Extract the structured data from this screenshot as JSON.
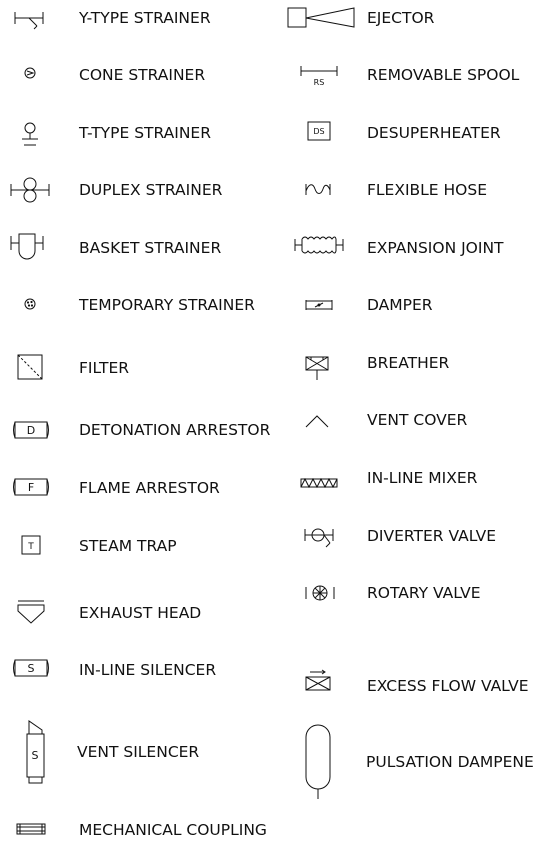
{
  "left_items": [
    {
      "label": "Y-TYPE STRAINER",
      "icon": "y-type-strainer"
    },
    {
      "label": "CONE STRAINER",
      "icon": "cone-strainer"
    },
    {
      "label": "T-TYPE STRAINER",
      "icon": "t-type-strainer"
    },
    {
      "label": "DUPLEX STRAINER",
      "icon": "duplex-strainer"
    },
    {
      "label": "BASKET STRAINER",
      "icon": "basket-strainer"
    },
    {
      "label": "TEMPORARY STRAINER",
      "icon": "temporary-strainer"
    },
    {
      "label": "FILTER",
      "icon": "filter"
    },
    {
      "label": "DETONATION ARRESTOR",
      "icon": "detonation-arrestor",
      "glyph": "D"
    },
    {
      "label": "FLAME ARRESTOR",
      "icon": "flame-arrestor",
      "glyph": "F"
    },
    {
      "label": "STEAM TRAP",
      "icon": "steam-trap",
      "glyph": "T"
    },
    {
      "label": "EXHAUST HEAD",
      "icon": "exhaust-head"
    },
    {
      "label": "IN-LINE SILENCER",
      "icon": "in-line-silencer",
      "glyph": "S"
    },
    {
      "label": "VENT SILENCER",
      "icon": "vent-silencer",
      "glyph": "S"
    },
    {
      "label": "MECHANICAL COUPLING",
      "icon": "mechanical-coupling"
    }
  ],
  "right_items": [
    {
      "label": "EJECTOR",
      "icon": "ejector"
    },
    {
      "label": "REMOVABLE SPOOL",
      "icon": "removable-spool",
      "glyph": "RS"
    },
    {
      "label": "DESUPERHEATER",
      "icon": "desuperheater",
      "glyph": "DS"
    },
    {
      "label": "FLEXIBLE HOSE",
      "icon": "flexible-hose"
    },
    {
      "label": "EXPANSION JOINT",
      "icon": "expansion-joint"
    },
    {
      "label": "DAMPER",
      "icon": "damper"
    },
    {
      "label": "BREATHER",
      "icon": "breather"
    },
    {
      "label": "VENT COVER",
      "icon": "vent-cover"
    },
    {
      "label": "IN-LINE MIXER",
      "icon": "in-line-mixer"
    },
    {
      "label": "DIVERTER VALVE",
      "icon": "diverter-valve"
    },
    {
      "label": "ROTARY VALVE",
      "icon": "rotary-valve"
    },
    {
      "label": "EXCESS FLOW VALVE",
      "icon": "excess-flow-valve"
    },
    {
      "label": "PULSATION DAMPENER",
      "icon": "pulsation-dampener"
    }
  ]
}
